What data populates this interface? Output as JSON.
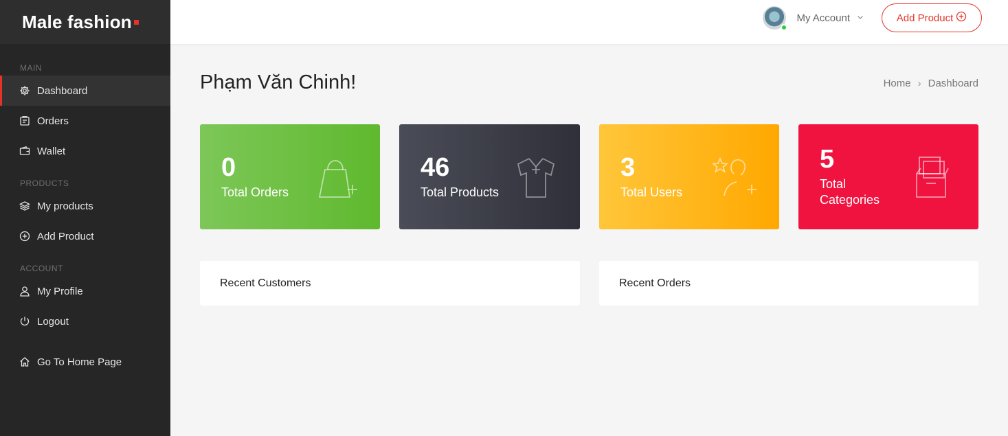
{
  "brand": {
    "name": "Male fashion"
  },
  "sidebar": {
    "sections": {
      "main": "MAIN",
      "products": "PRODUCTS",
      "account": "ACCOUNT"
    },
    "items": [
      {
        "label": "Dashboard",
        "icon": "gear-icon",
        "active": true
      },
      {
        "label": "Orders",
        "icon": "orders-icon"
      },
      {
        "label": "Wallet",
        "icon": "wallet-icon"
      },
      {
        "label": "My products",
        "icon": "layers-icon"
      },
      {
        "label": "Add Product",
        "icon": "plus-circle-icon"
      },
      {
        "label": "My Profile",
        "icon": "user-icon"
      },
      {
        "label": "Logout",
        "icon": "power-icon"
      },
      {
        "label": "Go To Home Page",
        "icon": "home-icon"
      }
    ]
  },
  "header": {
    "account_label": "My Account",
    "add_button_label": "Add Product"
  },
  "page": {
    "title": "Phạm Văn Chinh!",
    "breadcrumb": [
      "Home",
      "Dashboard"
    ]
  },
  "stats": [
    {
      "value": "0",
      "label": "Total Orders",
      "icon": "shopping-bag-icon",
      "color": "#6cbf3f"
    },
    {
      "value": "46",
      "label": "Total Products",
      "icon": "shirt-icon",
      "color": "#3b3d47"
    },
    {
      "value": "3",
      "label": "Total Users",
      "icon": "user-add-icon",
      "color": "#ffb518"
    },
    {
      "value": "5",
      "label": "Total Categories",
      "label_line1": "Total",
      "label_line2": "Categories",
      "icon": "boxes-icon",
      "color": "#f0123f"
    }
  ],
  "panels": {
    "recent_customers": "Recent Customers",
    "recent_orders": "Recent Orders"
  },
  "colors": {
    "accent": "#e5332a",
    "sidebar": "#262626"
  }
}
